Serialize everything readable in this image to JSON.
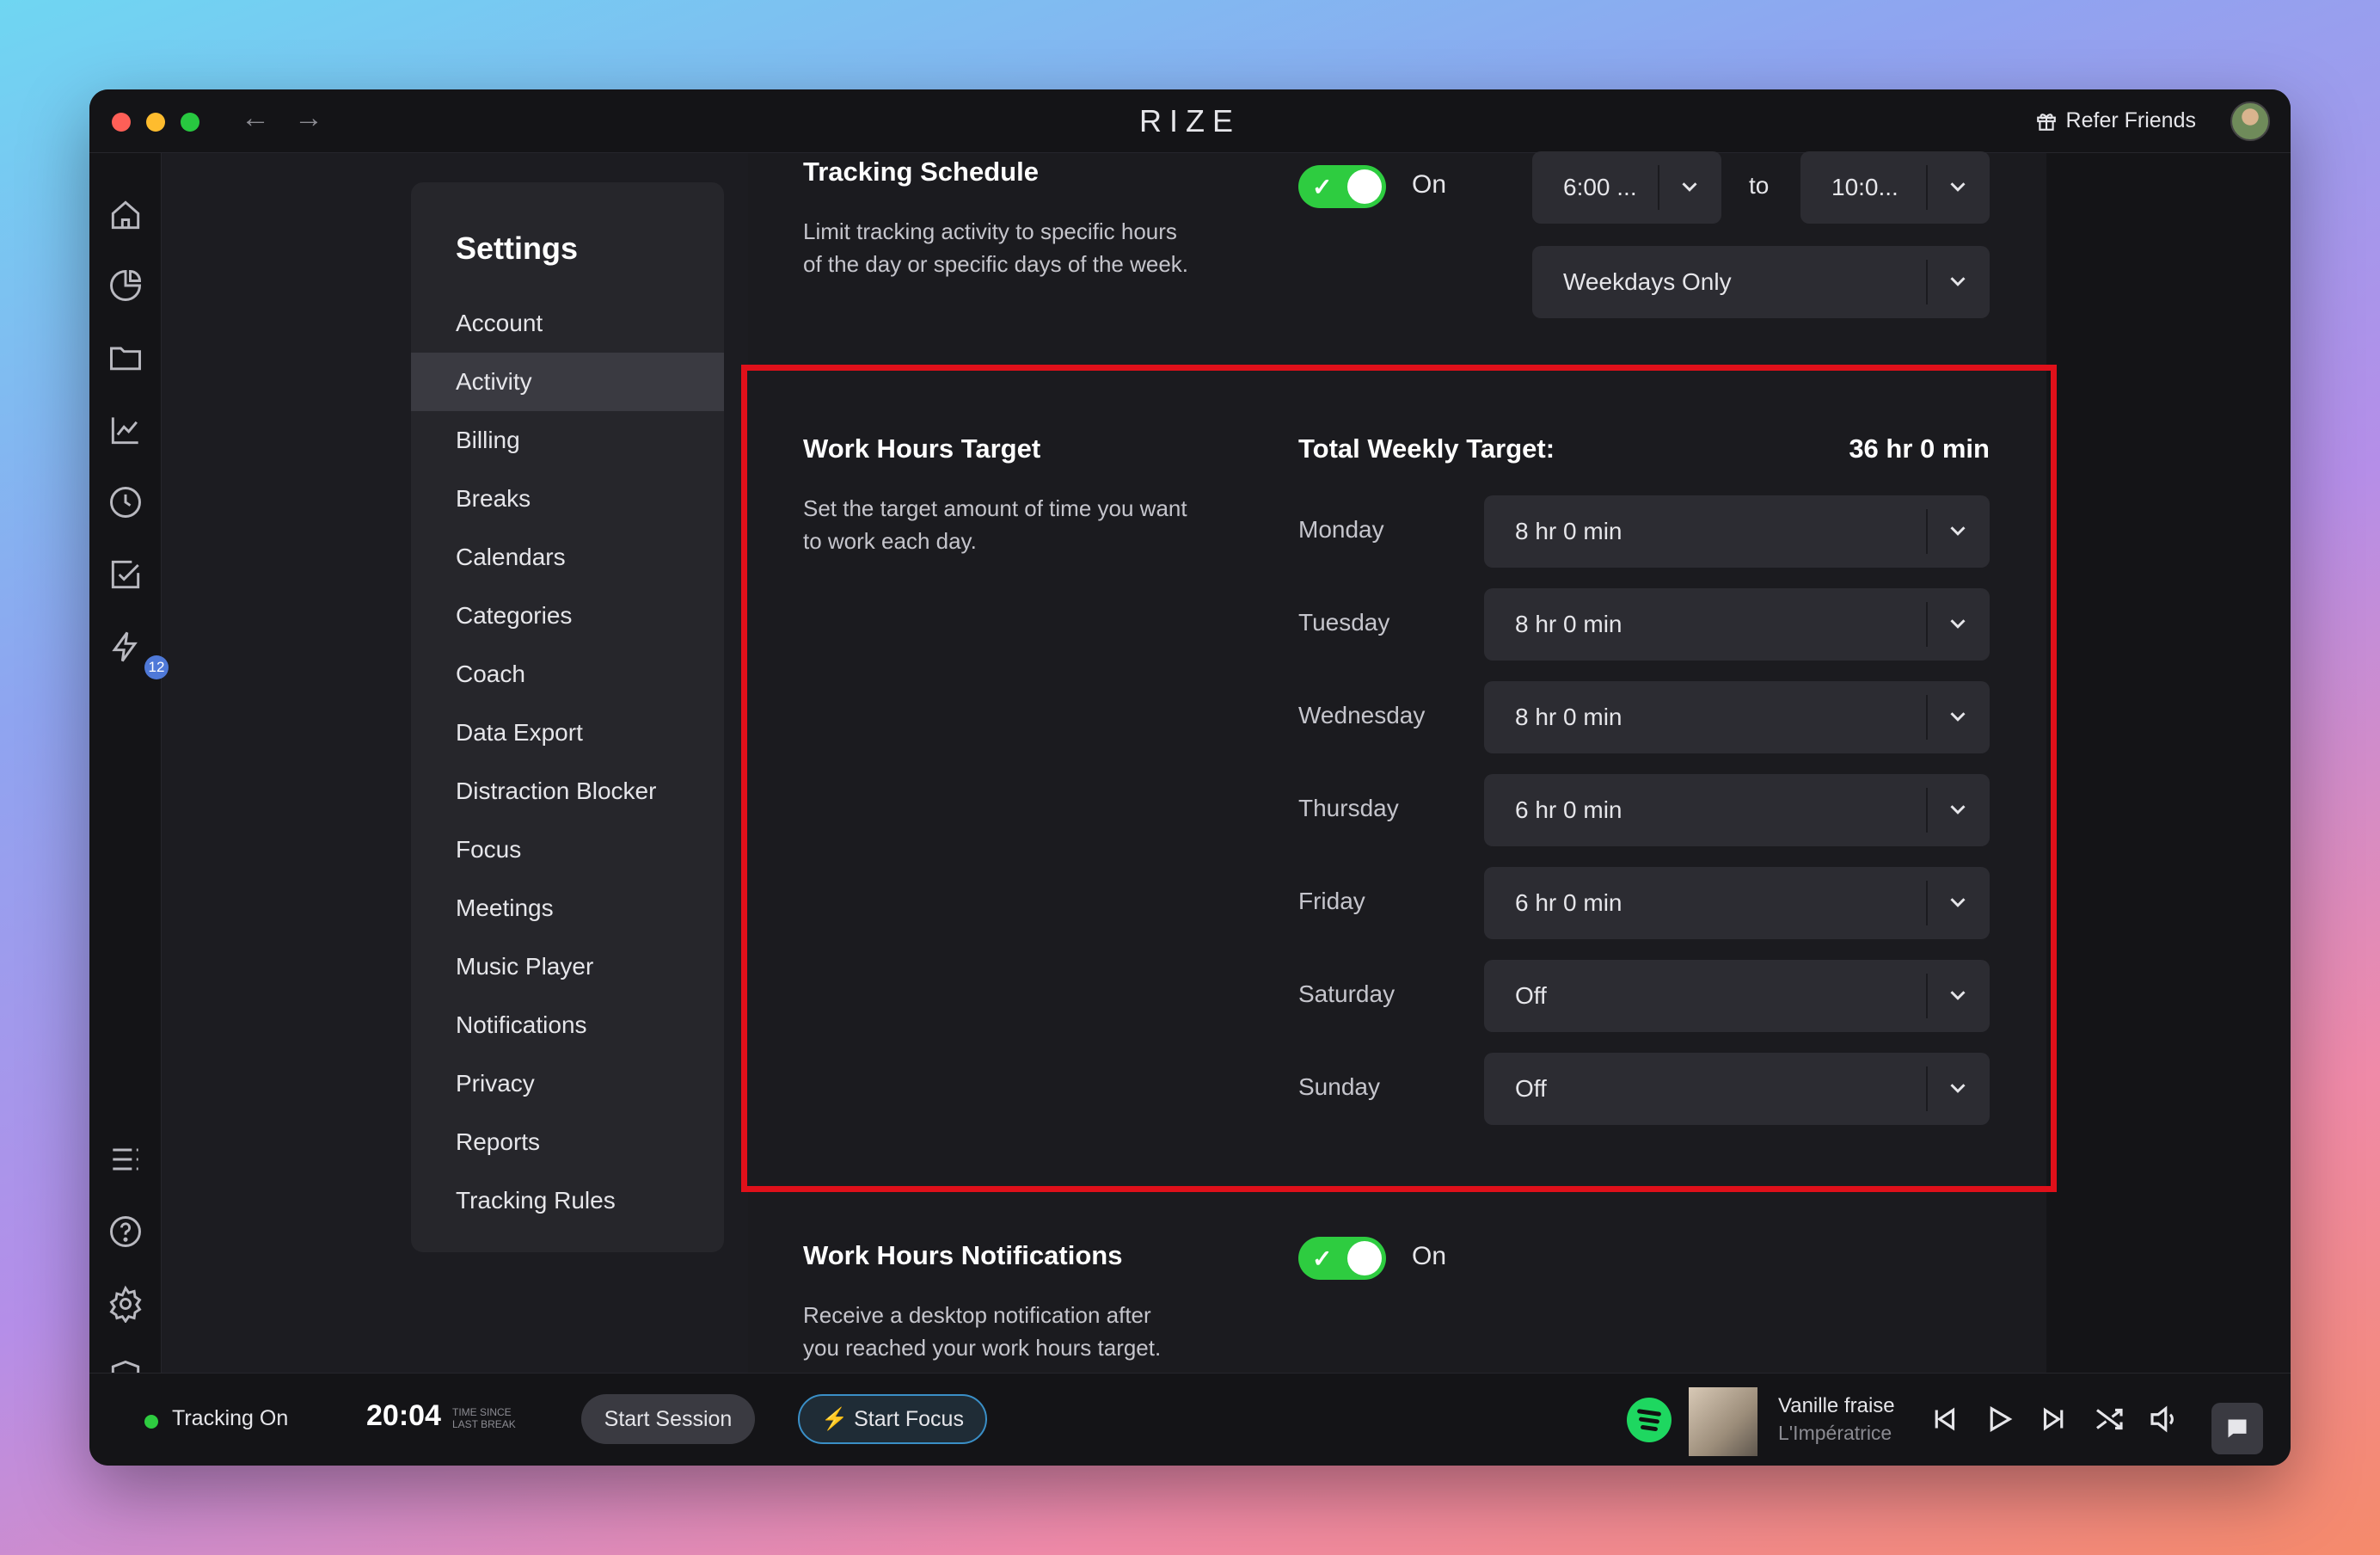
{
  "window": {
    "app_title": "RIZE",
    "back_arrow": "←",
    "forward_arrow": "→",
    "refer_label": "Refer Friends"
  },
  "iconbar": {
    "icons": [
      "home-icon",
      "pie-chart-icon",
      "folder-icon",
      "trend-chart-icon",
      "clock-icon",
      "checkbox-icon",
      "lightning-icon",
      "list-icon",
      "help-icon",
      "gear-icon",
      "shield-icon"
    ],
    "badge_count": "12"
  },
  "settings": {
    "title": "Settings",
    "items": [
      "Account",
      "Activity",
      "Billing",
      "Breaks",
      "Calendars",
      "Categories",
      "Coach",
      "Data Export",
      "Distraction Blocker",
      "Focus",
      "Meetings",
      "Music Player",
      "Notifications",
      "Privacy",
      "Reports",
      "Tracking Rules"
    ],
    "active": "Activity"
  },
  "tracking_schedule": {
    "title": "Tracking Schedule",
    "desc1": "Limit tracking activity to specific hours",
    "desc2": "of the day or specific days of the week.",
    "toggle_label": "On",
    "start_time": "6:00 ...",
    "to_label": "to",
    "end_time": "10:0...",
    "days": "Weekdays Only"
  },
  "work_hours_target": {
    "title": "Work Hours Target",
    "desc1": "Set the target amount of time you want",
    "desc2": "to work each day.",
    "total_label": "Total Weekly Target:",
    "total_value": "36 hr 0 min",
    "days": [
      {
        "day": "Monday",
        "value": "8 hr 0 min"
      },
      {
        "day": "Tuesday",
        "value": "8 hr 0 min"
      },
      {
        "day": "Wednesday",
        "value": "8 hr 0 min"
      },
      {
        "day": "Thursday",
        "value": "6 hr 0 min"
      },
      {
        "day": "Friday",
        "value": "6 hr 0 min"
      },
      {
        "day": "Saturday",
        "value": "Off"
      },
      {
        "day": "Sunday",
        "value": "Off"
      }
    ]
  },
  "work_hours_notifications": {
    "title": "Work Hours Notifications",
    "desc1": "Receive a desktop notification after",
    "desc2": "you reached your work hours target.",
    "toggle_label": "On"
  },
  "bottombar": {
    "tracking_status": "Tracking On",
    "time": "20:04",
    "time_caption": "TIME SINCE LAST BREAK",
    "start_session": "Start Session",
    "start_focus": "Start Focus",
    "track_title": "Vanille fraise",
    "track_artist": "L'Impératrice"
  },
  "colors": {
    "accent_green": "#2ecc40",
    "highlight_red": "#e0101a",
    "focus_blue": "#3a8fc7"
  }
}
